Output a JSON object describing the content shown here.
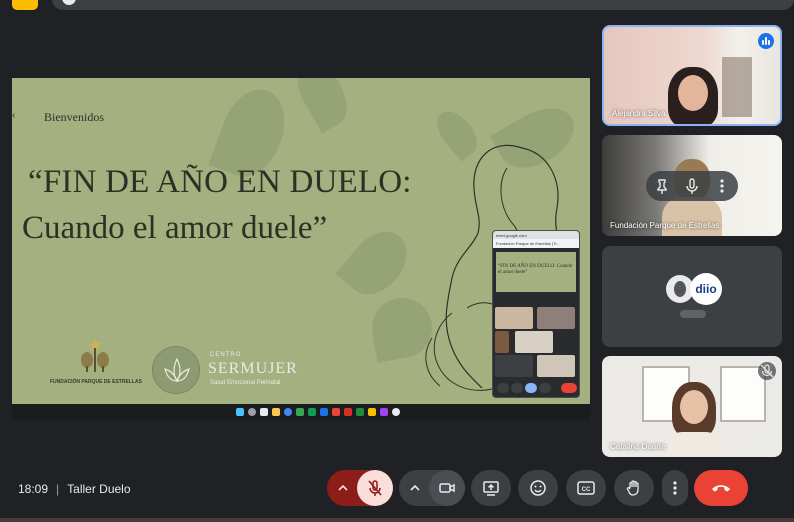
{
  "meeting": {
    "time": "18:09",
    "separator": "|",
    "title": "Taller Duelo"
  },
  "slide": {
    "welcome": "Bienvenidos",
    "title_line1": "“FIN DE AÑO EN DUELO:",
    "title_line2": "Cuando el amor duele”",
    "logo1_name": "FUNDACIÓN PARQUE DE ESTRELLAS",
    "logo2_label": "CENTRO",
    "logo2_name": "SERMUJER",
    "logo2_tagline": "Salud Emocional Perinatal"
  },
  "mini_window": {
    "tab_title": "Fundación Parque de Estrellas (Ti...",
    "slide_text": "“FIN DE AÑO EN DUELO: Cuando el amor duele”"
  },
  "participants": [
    {
      "name": "Alejandra Silva",
      "state": "speaking"
    },
    {
      "name": "Fundación Parque de Estrellas",
      "state": "hover-controls"
    },
    {
      "name": "",
      "state": "avatars",
      "logo_text": "diio"
    },
    {
      "name": "Catalina Duarte",
      "state": "muted"
    }
  ],
  "controls": [
    {
      "id": "audio-options",
      "icon": "chevron-up-icon"
    },
    {
      "id": "mic",
      "icon": "mic-off-icon",
      "state": "off"
    },
    {
      "id": "video-options",
      "icon": "chevron-up-icon"
    },
    {
      "id": "camera",
      "icon": "videocam-icon"
    },
    {
      "id": "present",
      "icon": "present-screen-icon"
    },
    {
      "id": "reactions",
      "icon": "emoji-icon"
    },
    {
      "id": "captions",
      "icon": "closed-captions-icon"
    },
    {
      "id": "raise-hand",
      "icon": "hand-icon"
    },
    {
      "id": "more",
      "icon": "more-vert-icon"
    },
    {
      "id": "leave",
      "icon": "call-end-icon"
    }
  ],
  "colors": {
    "background": "#202124",
    "control": "#3c4043",
    "mic_off_bg": "#f9dedc",
    "mic_off_group": "#8c1d18",
    "leave": "#ea4335",
    "speaking": "#1a73e8",
    "slide_bg": "#a4b080"
  }
}
